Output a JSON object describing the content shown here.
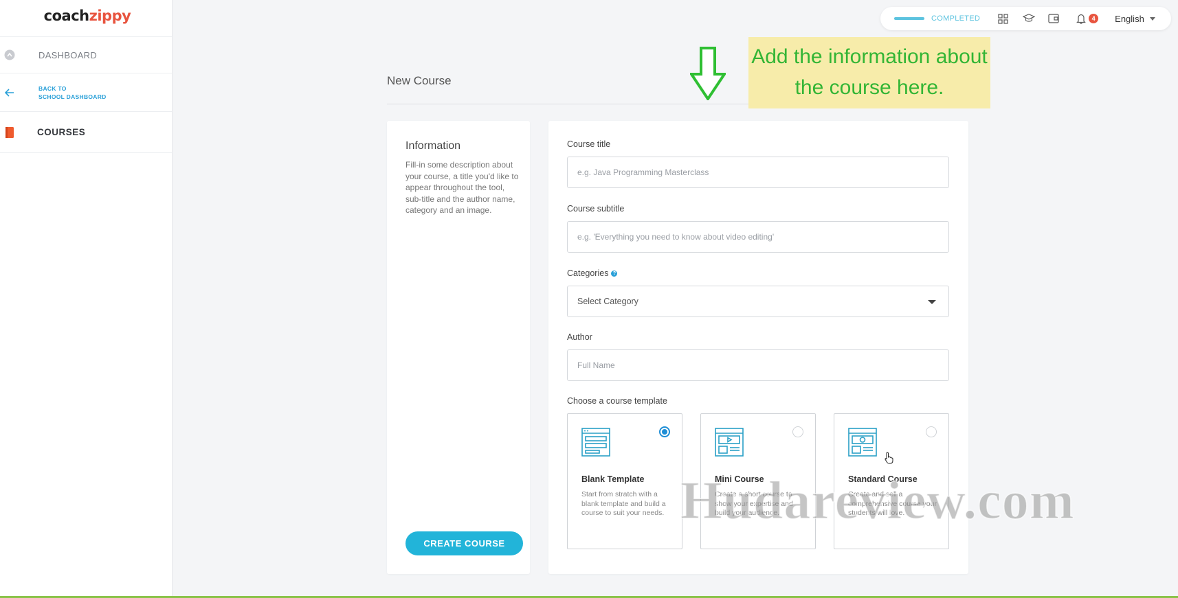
{
  "app": {
    "logo_prefix": "coach",
    "logo_accent": "zippy",
    "brand_color": "#e8543f",
    "accent_color": "#22b4d9"
  },
  "sidebar": {
    "items": [
      {
        "label": "DASHBOARD",
        "icon": "dashboard-icon"
      },
      {
        "label": "BACK TO\nSCHOOL DASHBOARD",
        "icon": "arrow-left-icon"
      },
      {
        "label": "COURSES",
        "icon": "book-icon"
      }
    ]
  },
  "topbar": {
    "progress_label": "COMPLETED",
    "progress_fraction": 1.0,
    "notification_count": "4",
    "language": "English",
    "icons": [
      "grid-icon",
      "graduation-cap-icon",
      "wallet-icon",
      "bell-icon"
    ]
  },
  "page": {
    "title": "New Course"
  },
  "annotation": {
    "text": "Add the information about the course here.",
    "bg_color": "#f7ecaa",
    "text_color": "#33b535"
  },
  "info_panel": {
    "title": "Information",
    "description": "Fill-in some description about your course, a title you'd like to appear throughout the tool, sub-title and the author name, category and an image.",
    "create_button": "CREATE COURSE"
  },
  "form": {
    "course_title": {
      "label": "Course title",
      "placeholder": "e.g. Java Programming Masterclass",
      "value": ""
    },
    "course_subtitle": {
      "label": "Course subtitle",
      "placeholder": "e.g. 'Everything you need to know about video editing'",
      "value": ""
    },
    "categories": {
      "label": "Categories",
      "selected": "Select Category"
    },
    "author": {
      "label": "Author",
      "placeholder": "Full Name",
      "value": ""
    },
    "template_label": "Choose a course template",
    "templates": [
      {
        "name": "Blank Template",
        "description": "Start from stratch with a blank template and build a course to suit your needs.",
        "selected": true
      },
      {
        "name": "Mini Course",
        "description": "Create a short course to show your expertise and build your audience.",
        "selected": false
      },
      {
        "name": "Standard Course",
        "description": "Create and sell a comprehensive course your students will love.",
        "selected": false
      }
    ]
  },
  "watermark": "Hudareview.com"
}
